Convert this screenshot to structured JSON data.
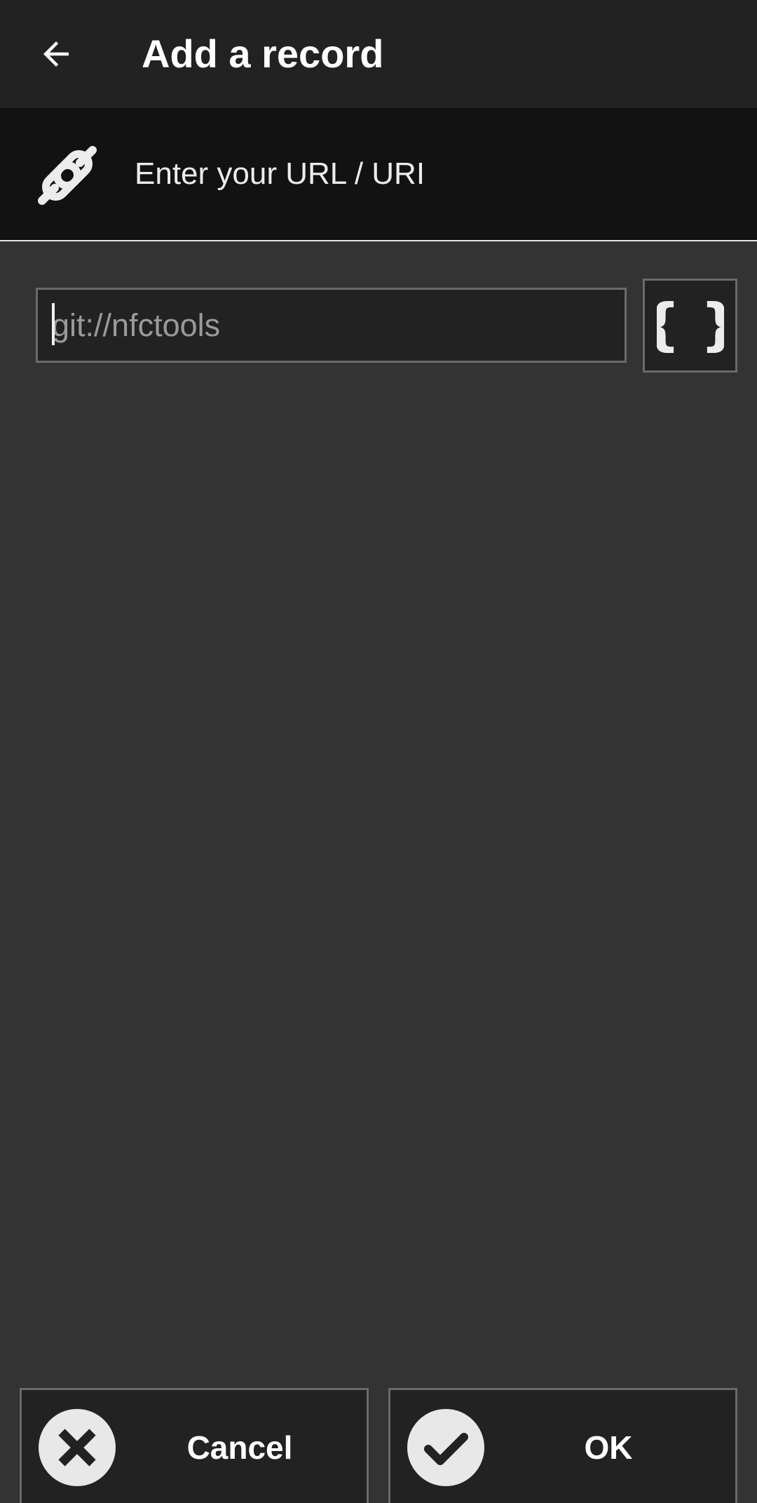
{
  "header": {
    "title": "Add a record",
    "back_icon": "arrow-left-icon"
  },
  "record_type": {
    "icon": "link-icon",
    "label": "Enter your URL / URI"
  },
  "url_field": {
    "placeholder": "git://nfctools",
    "value": ""
  },
  "variables_button": {
    "icon": "curly-braces-icon"
  },
  "actions": {
    "cancel_label": "Cancel",
    "cancel_icon": "close-circle-icon",
    "ok_label": "OK",
    "ok_icon": "check-circle-icon"
  },
  "colors": {
    "background": "#333333",
    "app_bar": "#222222",
    "record_header": "#121212",
    "field_border": "#6a6a6a",
    "text": "#ffffff"
  }
}
